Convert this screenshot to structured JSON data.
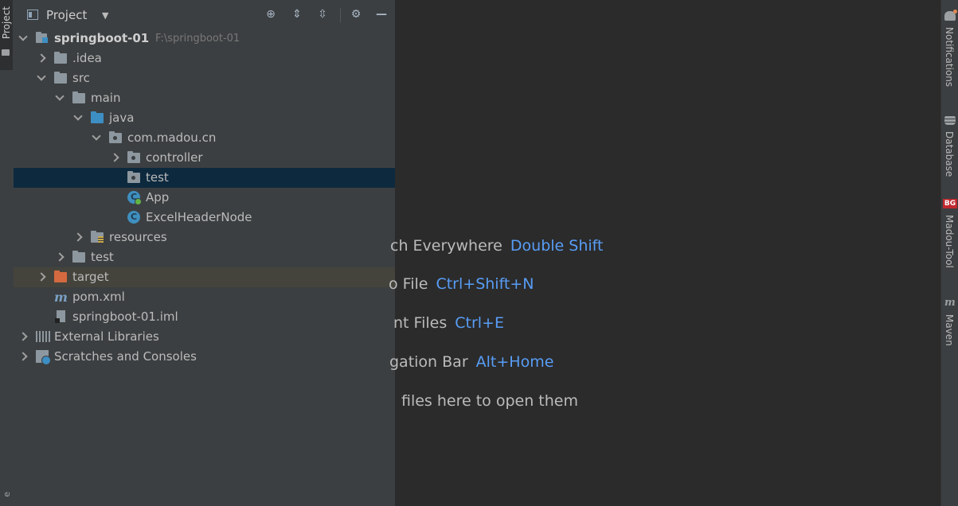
{
  "left_strip": {
    "tab_label": "Project",
    "bottom_glyph": "e"
  },
  "panel": {
    "title": "Project",
    "tools": [
      "locate-icon",
      "expand-all-icon",
      "collapse-all-icon",
      "gear-icon",
      "minimize-icon"
    ]
  },
  "tree": [
    {
      "label": "springboot-01",
      "path": "F:\\springboot-01",
      "icon": "module-folder-icon",
      "depth": 0,
      "state": "expanded",
      "bold": true
    },
    {
      "label": ".idea",
      "icon": "folder-icon",
      "depth": 1,
      "state": "collapsed"
    },
    {
      "label": "src",
      "icon": "folder-icon",
      "depth": 1,
      "state": "expanded"
    },
    {
      "label": "main",
      "icon": "folder-icon",
      "depth": 2,
      "state": "expanded"
    },
    {
      "label": "java",
      "icon": "source-folder-icon",
      "depth": 3,
      "state": "expanded"
    },
    {
      "label": "com.madou.cn",
      "icon": "package-icon",
      "depth": 4,
      "state": "expanded"
    },
    {
      "label": "controller",
      "icon": "package-icon",
      "depth": 5,
      "state": "collapsed"
    },
    {
      "label": "test",
      "icon": "package-icon",
      "depth": 5,
      "state": "leaf",
      "selected": true
    },
    {
      "label": "App",
      "icon": "spring-class-icon",
      "depth": 5,
      "state": "leaf"
    },
    {
      "label": "ExcelHeaderNode",
      "icon": "class-icon",
      "depth": 5,
      "state": "leaf"
    },
    {
      "label": "resources",
      "icon": "resources-folder-icon",
      "depth": 3,
      "state": "collapsed"
    },
    {
      "label": "test",
      "icon": "folder-icon",
      "depth": 2,
      "state": "collapsed"
    },
    {
      "label": "target",
      "icon": "excluded-folder-icon",
      "depth": 1,
      "state": "collapsed",
      "excluded": true
    },
    {
      "label": "pom.xml",
      "icon": "maven-icon",
      "depth": 1,
      "state": "leaf"
    },
    {
      "label": "springboot-01.iml",
      "icon": "iml-file-icon",
      "depth": 1,
      "state": "leaf"
    },
    {
      "label": "External Libraries",
      "icon": "libraries-icon",
      "depth": 0,
      "state": "collapsed"
    },
    {
      "label": "Scratches and Consoles",
      "icon": "scratches-icon",
      "depth": 0,
      "state": "collapsed"
    }
  ],
  "editor_hints": [
    {
      "text": "ch Everywhere",
      "shortcut": "Double Shift"
    },
    {
      "text": "o File",
      "shortcut": "Ctrl+Shift+N"
    },
    {
      "text": "nt Files",
      "shortcut": "Ctrl+E"
    },
    {
      "text": "gation Bar",
      "shortcut": "Alt+Home"
    },
    {
      "text": "files here to open them",
      "shortcut": ""
    }
  ],
  "right_strip": [
    {
      "label": "Notifications",
      "icon": "bell-icon"
    },
    {
      "label": "Database",
      "icon": "database-icon"
    },
    {
      "label": "Madou-Tool",
      "icon": "plugin-badge-icon",
      "badge": "BG"
    },
    {
      "label": "Maven",
      "icon": "maven-icon",
      "glyph": "m"
    }
  ],
  "colors": {
    "accent": "#589df6",
    "selection": "#0d293e",
    "excluded": "#45443c",
    "panel": "#3c3f41",
    "editor": "#2b2b2b"
  }
}
